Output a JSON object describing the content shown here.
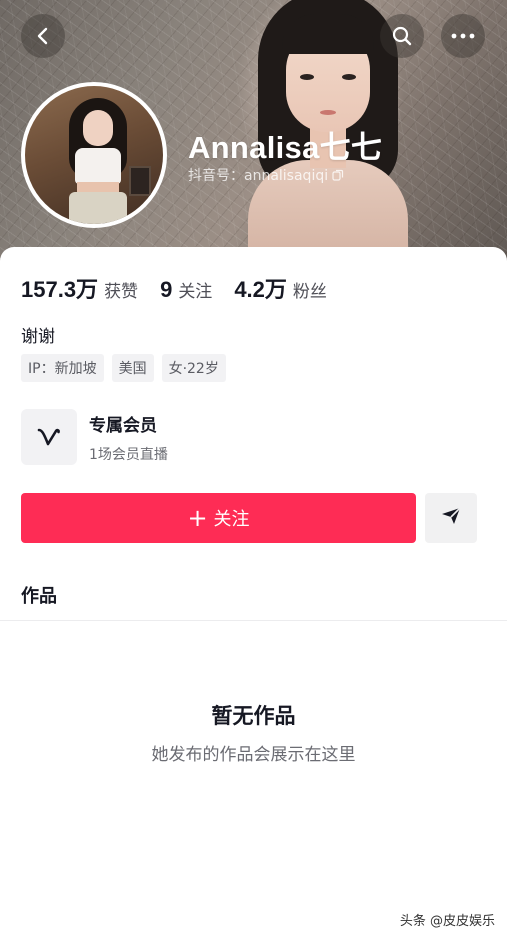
{
  "profile": {
    "username": "Annalisa七七",
    "douyin_id": "抖音号：annalisaqiqi",
    "bio": "谢谢",
    "tags": [
      "IP：新加坡",
      "美国",
      "女·22岁"
    ]
  },
  "stats": [
    {
      "value": "157.3万",
      "label": "获赞"
    },
    {
      "value": "9",
      "label": "关注"
    },
    {
      "value": "4.2万",
      "label": "粉丝"
    }
  ],
  "membership": {
    "title": "专属会员",
    "subtitle": "1场会员直播"
  },
  "actions": {
    "follow_label": "关注",
    "follow_plus": "+"
  },
  "tabs": {
    "works": "作品"
  },
  "empty_state": {
    "title": "暂无作品",
    "subtitle": "她发布的作品会展示在这里"
  },
  "watermark": "头条 @皮皮娱乐",
  "icons": {
    "back": "chevron-left-icon",
    "search": "search-icon",
    "more": "more-dots-icon",
    "copy": "copy-icon",
    "member": "v-membership-icon",
    "share": "send-arrow-icon"
  },
  "colors": {
    "accent": "#fe2c55",
    "text_primary": "#161823",
    "text_secondary": "#6b6c73",
    "tag_bg": "#f2f2f4"
  }
}
